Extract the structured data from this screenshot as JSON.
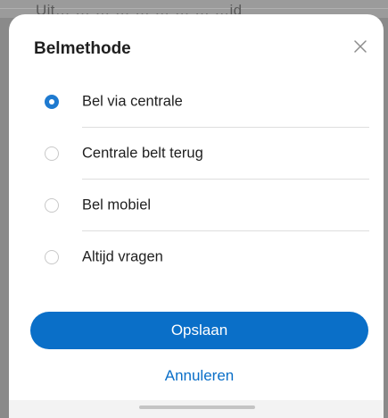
{
  "background": {
    "partial_text": "Uit… … … … … … … … …id"
  },
  "dialog": {
    "title": "Belmethode",
    "close_icon": "close-icon",
    "options": [
      {
        "label": "Bel via centrale",
        "selected": true
      },
      {
        "label": "Centrale belt terug",
        "selected": false
      },
      {
        "label": "Bel mobiel",
        "selected": false
      },
      {
        "label": "Altijd vragen",
        "selected": false
      }
    ],
    "save_label": "Opslaan",
    "cancel_label": "Annuleren"
  },
  "colors": {
    "accent": "#0a6fc8",
    "radio_selected": "#1e7ad0",
    "text": "#1f1f1f"
  }
}
